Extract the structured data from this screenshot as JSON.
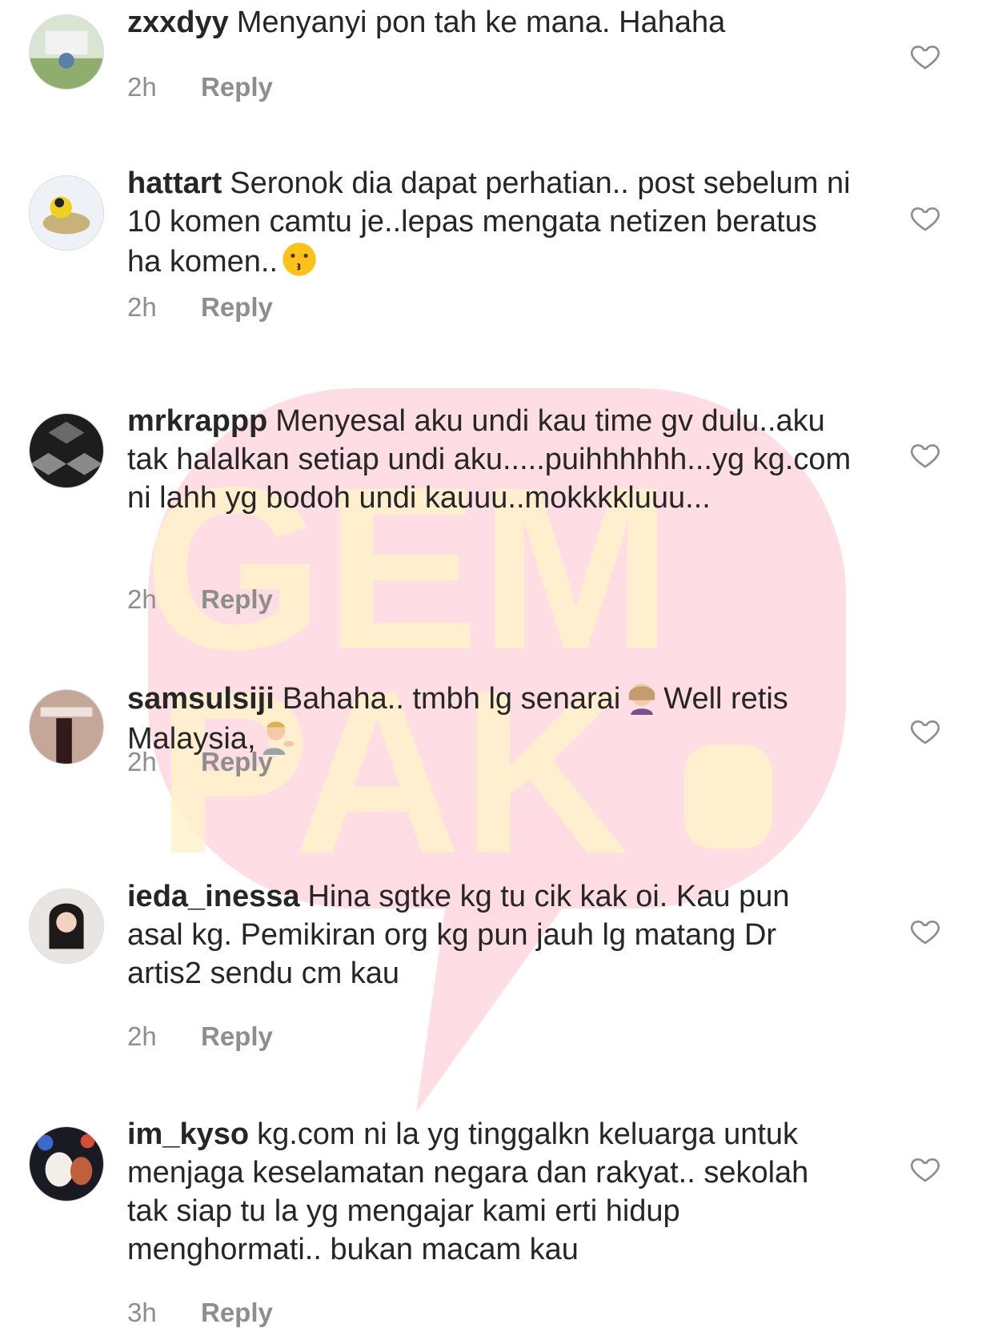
{
  "watermark": "GEM PAK",
  "comments": [
    {
      "username": "zxxdyy",
      "text": "Menyanyi pon tah ke mana. Hahaha",
      "time": "2h",
      "reply_label": "Reply"
    },
    {
      "username": "hattart",
      "text": "Seronok dia dapat perhatian.. post sebelum ni 10 komen camtu je..lepas mengata netizen beratus ha komen..",
      "emoji": "kissing-face",
      "time": "2h",
      "reply_label": "Reply"
    },
    {
      "username": "mrkrappp",
      "text": "Menyesal aku undi kau time gv dulu..aku tak halalkan setiap undi aku.....puihhhhhh...yg kg.com ni lahh yg bodoh undi kauuu..mokkkkluuu...",
      "time": "2h",
      "reply_label": "Reply"
    },
    {
      "username": "samsulsiji",
      "text_a": "Bahaha.. tmbh lg senarai",
      "emoji_a": "woman-getting-massage",
      "text_b": "Well retis Malaysia,",
      "emoji_b": "person-tipping-hand",
      "time": "2h",
      "reply_label": "Reply"
    },
    {
      "username": "ieda_inessa",
      "text": "Hina sgtke kg tu cik kak oi. Kau pun asal kg. Pemikiran org kg pun jauh lg matang Dr artis2 sendu cm kau",
      "time": "2h",
      "reply_label": "Reply"
    },
    {
      "username": "im_kyso",
      "text": "kg.com ni la yg tinggalkn keluarga untuk menjaga keselamatan negara dan rakyat.. sekolah tak siap tu la yg mengajar kami erti hidup menghormati.. bukan macam kau",
      "time": "3h",
      "reply_label": "Reply"
    }
  ]
}
